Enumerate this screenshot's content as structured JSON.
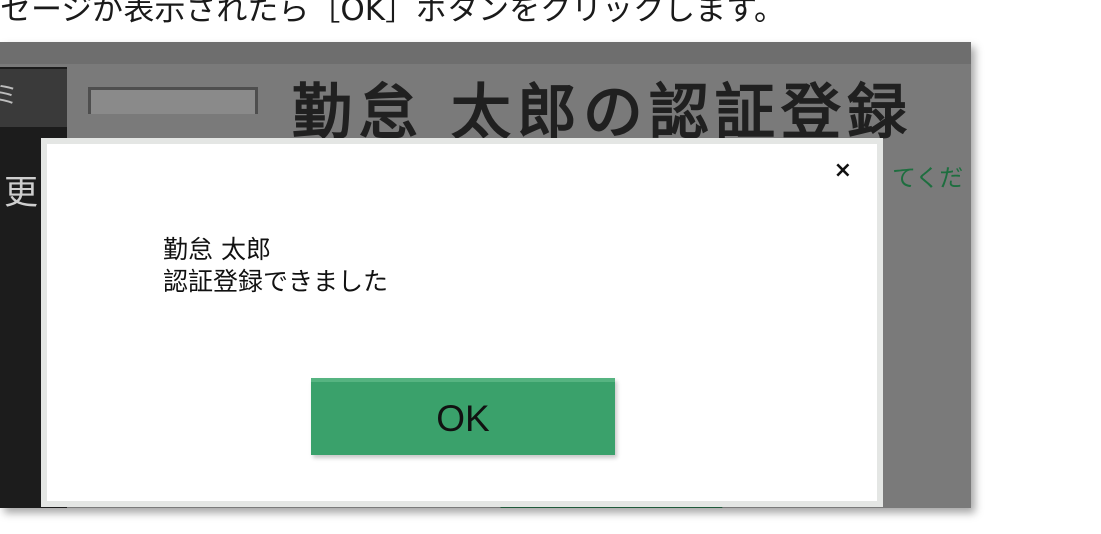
{
  "caption": "セージが表示されたら［OK］ボタンをクリックします。",
  "background": {
    "sidebar_chip_text": "ミ",
    "sidebar_item": "更",
    "title": "勤怠 太郎の認証登録",
    "instruction": "てくだ"
  },
  "dialog": {
    "close_glyph": "×",
    "message_line1": "勤怠 太郎",
    "message_line2": "認証登録できました",
    "ok_label": "OK"
  },
  "colors": {
    "ok_button": "#3aa16b",
    "overlay": "#7a7a7a",
    "sidebar": "#1c1c1c",
    "instruction_text": "#1e6e3f"
  }
}
